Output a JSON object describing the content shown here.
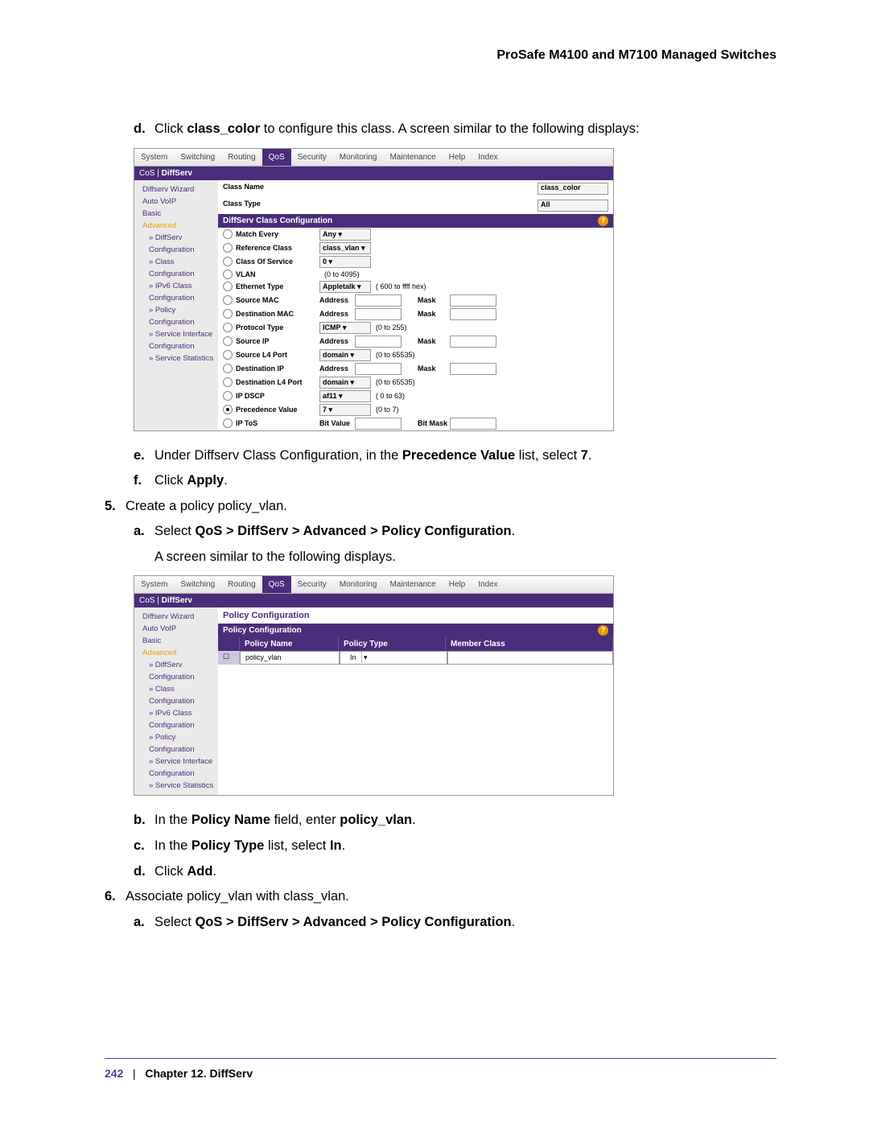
{
  "header": {
    "title": "ProSafe M4100 and M7100 Managed Switches"
  },
  "footer": {
    "page": "242",
    "sep": "|",
    "chapter": "Chapter 12.  DiffServ"
  },
  "steps": {
    "d_marker": "d.",
    "d_pre": "Click ",
    "d_bold": "class_color",
    "d_post": " to configure this class. A screen similar to the following displays:",
    "e_marker": "e.",
    "e_pre": "Under Diffserv Class Configuration, in the ",
    "e_bold": "Precedence Value",
    "e_post": " list, select ",
    "e_val": "7",
    "e_end": ".",
    "f_marker": "f.",
    "f_pre": "Click ",
    "f_bold": "Apply",
    "f_end": ".",
    "s5_marker": "5.",
    "s5_text": "Create a policy policy_vlan.",
    "s5a_marker": "a.",
    "s5a_pre": "Select ",
    "s5a_bold": "QoS > DiffServ > Advanced > Policy Configuration",
    "s5a_end": ".",
    "s5a_sub": "A screen similar to the following displays.",
    "s5b_marker": "b.",
    "s5b_pre": "In the ",
    "s5b_b1": "Policy Name",
    "s5b_mid": " field, enter ",
    "s5b_b2": "policy_vlan",
    "s5b_end": ".",
    "s5c_marker": "c.",
    "s5c_pre": "In the ",
    "s5c_b1": "Policy Type",
    "s5c_mid": " list, select ",
    "s5c_b2": "In",
    "s5c_end": ".",
    "s5d_marker": "d.",
    "s5d_pre": "Click ",
    "s5d_bold": "Add",
    "s5d_end": ".",
    "s6_marker": "6.",
    "s6_text": "Associate policy_vlan with class_vlan.",
    "s6a_marker": "a.",
    "s6a_pre": "Select ",
    "s6a_bold": "QoS > DiffServ > Advanced > Policy Configuration",
    "s6a_end": "."
  },
  "ui": {
    "tabs": [
      "System",
      "Switching",
      "Routing",
      "QoS",
      "Security",
      "Monitoring",
      "Maintenance",
      "Help",
      "Index"
    ],
    "crumb1": "CoS",
    "crumb2": "DiffServ",
    "sidebar1": [
      "Diffserv Wizard",
      "Auto VoIP",
      "Basic",
      "Advanced",
      "» DiffServ",
      "Configuration",
      "» Class",
      "Configuration",
      "» IPv6 Class",
      "Configuration",
      "» Policy",
      "Configuration",
      "» Service Interface",
      "Configuration",
      "» Service Statistics"
    ],
    "sidebar2": [
      "Diffserv Wizard",
      "Auto VoIP",
      "Basic",
      "Advanced",
      "» DiffServ",
      "Configuration",
      "» Class",
      "Configuration",
      "» IPv6 Class",
      "Configuration",
      "» Policy",
      "Configuration",
      "» Service Interface",
      "Configuration",
      "» Service Statistics"
    ],
    "class_name_lab": "Class Name",
    "class_name_val": "class_color",
    "class_type_lab": "Class Type",
    "class_type_val": "All",
    "cfg_title": "DiffServ Class Configuration",
    "rows": [
      {
        "lab": "Match Every",
        "sel": "Any"
      },
      {
        "lab": "Reference Class",
        "sel": "class_vlan"
      },
      {
        "lab": "Class Of Service",
        "sel": "0"
      },
      {
        "lab": "VLAN",
        "note": "(0 to 4095)"
      },
      {
        "lab": "Ethernet Type",
        "sel": "Appletalk",
        "note": "( 600 to ffff hex)"
      },
      {
        "lab": "Source MAC",
        "a": "Address",
        "m": "Mask"
      },
      {
        "lab": "Destination MAC",
        "a": "Address",
        "m": "Mask"
      },
      {
        "lab": "Protocol Type",
        "sel": "ICMP",
        "note": "(0 to 255)"
      },
      {
        "lab": "Source IP",
        "a": "Address",
        "m": "Mask"
      },
      {
        "lab": "Source L4 Port",
        "sel": "domain",
        "note": "(0 to 65535)"
      },
      {
        "lab": "Destination IP",
        "a": "Address",
        "m": "Mask"
      },
      {
        "lab": "Destination L4 Port",
        "sel": "domain",
        "note": "(0 to 65535)"
      },
      {
        "lab": "IP DSCP",
        "sel": "af11",
        "note": "( 0 to 63)"
      },
      {
        "lab": "Precedence Value",
        "sel": "7",
        "note": "(0 to 7)",
        "checked": true
      },
      {
        "lab": "IP ToS",
        "a": "Bit Value",
        "m": "Bit Mask"
      }
    ],
    "pc_title": "Policy Configuration",
    "pc_head": [
      "Policy Name",
      "Policy Type",
      "Member Class"
    ],
    "pc_row": [
      "policy_vlan",
      "In",
      ""
    ]
  }
}
